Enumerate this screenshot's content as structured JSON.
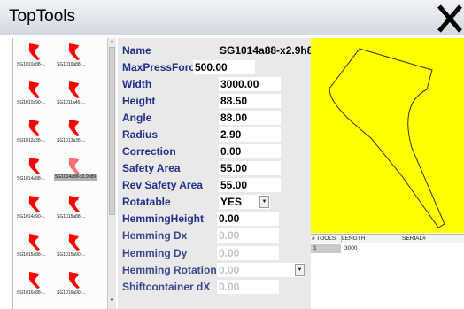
{
  "window": {
    "title": "TopTools",
    "close_icon": "close-x-icon"
  },
  "tools": [
    {
      "label": "SG1010a88-...",
      "selected": false
    },
    {
      "label": "SG1010a88-...",
      "selected": false
    },
    {
      "label": "SG1010a90-...",
      "selected": false
    },
    {
      "label": "SG1011a45-...",
      "selected": false
    },
    {
      "label": "SG1012a35-...",
      "selected": false
    },
    {
      "label": "SG1013a35-...",
      "selected": false
    },
    {
      "label": "SG1014a88-...",
      "selected": false
    },
    {
      "label": "SG1014a88-x2.9h89",
      "selected": true
    },
    {
      "label": "SG1014a90-...",
      "selected": false
    },
    {
      "label": "SG1015a88-...",
      "selected": false
    },
    {
      "label": "SG1015a88-...",
      "selected": false
    },
    {
      "label": "SG1015a90-...",
      "selected": false
    },
    {
      "label": "SG1016a88-...",
      "selected": false
    },
    {
      "label": "SG1016a90-...",
      "selected": false
    }
  ],
  "tool_icon": "punch-tool-icon",
  "tool_color": "#ff0000",
  "properties": [
    {
      "label": "Name",
      "value": "SG1014a88-x2.9h8",
      "disabled": false
    },
    {
      "label": "MaxPressForce",
      "value": "500.00",
      "disabled": false
    },
    {
      "label": "Width",
      "value": "3000.00",
      "disabled": false
    },
    {
      "label": "Height",
      "value": "88.50",
      "disabled": false
    },
    {
      "label": "Angle",
      "value": "88.00",
      "disabled": false
    },
    {
      "label": "Radius",
      "value": "2.90",
      "disabled": false
    },
    {
      "label": "Correction",
      "value": "0.00",
      "disabled": false
    },
    {
      "label": "Safety Area",
      "value": "55.00",
      "disabled": false
    },
    {
      "label": "Rev Safety Area",
      "value": "55.00",
      "disabled": false
    },
    {
      "label": "Rotatable",
      "value": "YES",
      "disabled": false,
      "dropdown": true
    },
    {
      "label": "HemmingHeight",
      "value": "0.00",
      "disabled": false
    },
    {
      "label": "Hemming Dx",
      "value": "0.00",
      "disabled": true
    },
    {
      "label": "Hemming Dy",
      "value": "0.00",
      "disabled": true
    },
    {
      "label": "Hemming Rotation",
      "value": "0.00",
      "disabled": true,
      "dropdown": true
    },
    {
      "label": "Shiftcontainer dX",
      "value": "0.00",
      "disabled": true
    }
  ],
  "preview": {
    "background": "#ffff00",
    "outline_color": "#3a3a00"
  },
  "tools_table": {
    "columns": [
      "# TOOLS",
      "LENGTH",
      "SERIAL#"
    ],
    "rows": [
      {
        "count": "1",
        "length": "3000",
        "serial": ""
      }
    ]
  }
}
